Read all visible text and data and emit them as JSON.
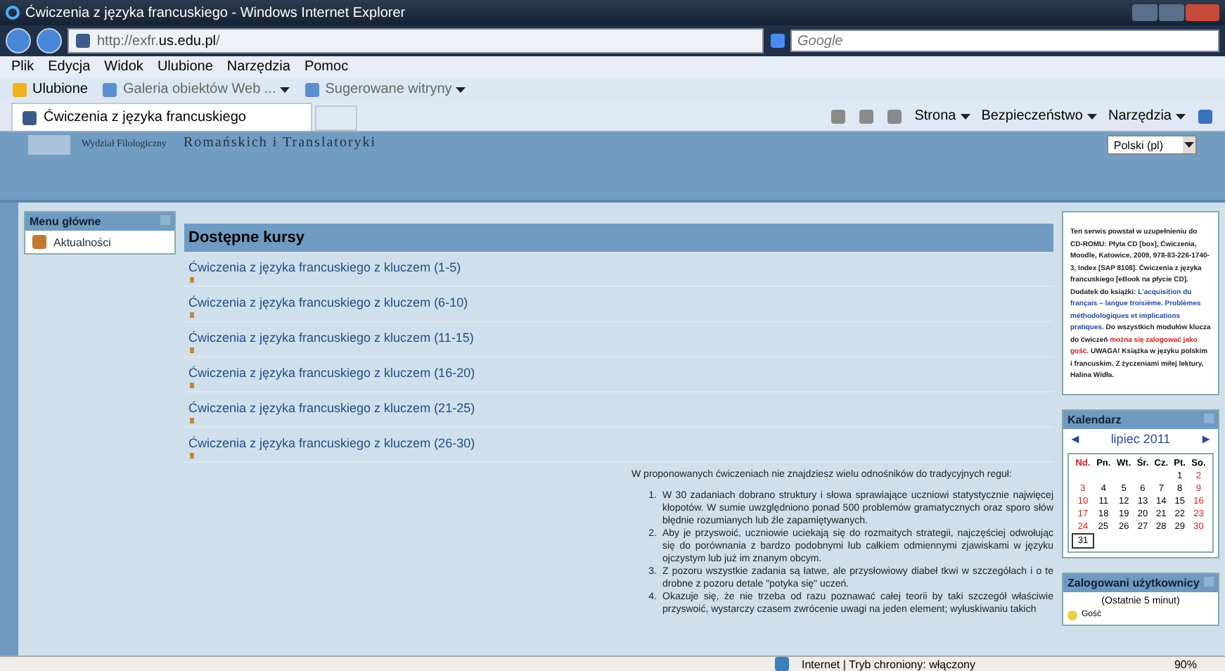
{
  "window": {
    "title": "Ćwiczenia z języka francuskiego - Windows Internet Explorer"
  },
  "address_bar": {
    "url_prefix": "http://exfr.",
    "url_domain": "us.edu.pl",
    "url_suffix": "/",
    "search_placeholder": "Google"
  },
  "menu_bar": [
    "Plik",
    "Edycja",
    "Widok",
    "Ulubione",
    "Narzędzia",
    "Pomoc"
  ],
  "favorites_bar": {
    "favorites": "Ulubione",
    "items": [
      "Galeria obiektów Web ...",
      "Sugerowane witryny"
    ]
  },
  "tab": {
    "title": "Ćwiczenia z języka francuskiego",
    "selected": true
  },
  "command_bar": [
    "Strona",
    "Bezpieczeństwo",
    "Narzędzia"
  ],
  "header": {
    "faculty": "Wydział Filologiczny",
    "institute": "Romańskich i Translatoryki",
    "language": "Polski (pl)"
  },
  "main_menu": {
    "title": "Menu główne",
    "items": [
      "Aktualności"
    ]
  },
  "courses": {
    "title": "Dostępne kursy",
    "items": [
      {
        "name": "Ćwiczenia z języka francuskiego z kluczem (1-5)"
      },
      {
        "name": "Ćwiczenia z języka francuskiego z kluczem (6-10)"
      },
      {
        "name": "Ćwiczenia z języka francuskiego z kluczem (11-15)"
      },
      {
        "name": "Ćwiczenia z języka francuskiego z kluczem (16-20)"
      },
      {
        "name": "Ćwiczenia z języka francuskiego z kluczem (21-25)"
      },
      {
        "name": "Ćwiczenia z języka francuskiego z kluczem (26-30)"
      }
    ]
  },
  "intro": {
    "lead": "W proponowanych ćwiczeniach nie znajdziesz wielu odnośników do tradycyjnych reguł:",
    "points": [
      {
        "marker": "1.",
        "text": "W 30 zadaniach dobrano struktury i słowa sprawiające uczniowi statystycznie najwięcej kłopotów. W sumie uwzględniono ponad 500 problemów gramatycznych oraz sporo słów błędnie rozumianych lub źle zapamiętywanych."
      },
      {
        "marker": "2.",
        "text": "Aby je przyswoić, uczniowie uciekają się do rozmaitych strategii, najczęściej odwołując się do porównania z bardzo podobnymi lub całkiem odmiennymi zjawiskami w języku ojczystym lub już im znanym obcym."
      },
      {
        "marker": "3.",
        "text": "Z pozoru wszystkie zadania są łatwe, ale przysłowiowy diabeł tkwi w szczegółach i o te drobne z pozoru detale \"potyka się\" uczeń."
      },
      {
        "marker": "4.",
        "text": "Okazuje się, że nie trzeba od razu poznawać całej teorii by taki szczegół właściwie przyswoić, wystarczy czasem zwrócenie uwagi na jeden element; wyłuskiwaniu takich"
      }
    ]
  },
  "info_box": [
    {
      "kind": "plain",
      "text": "Ten serwis powstał w uzupełnieniu do CD-ROMU: Płyta CD [box], Ćwiczenia, Moodle, Katowice, 2009, 978-83-226-1740-3, Index [SAP 8108]. Ćwiczenia z języka francuskiego [eBook na płycie CD]. Dodatek do książki: "
    },
    {
      "kind": "link",
      "text": "L'acquisition du français – langue troisième. Problèmes méthodologiques et implications pratiques."
    },
    {
      "kind": "plain",
      "text": " Do wszystkich modułów klucza do ćwiczeń "
    },
    {
      "kind": "alert",
      "text": "można się zalogować jako gość."
    },
    {
      "kind": "plain",
      "text": " UWAGA! Książka w języku polskim i francuskim. Z życzeniami miłej lektury, Halina Widła."
    }
  ],
  "calendar": {
    "title": "Kalendarz",
    "prev": "◄",
    "month": "lipiec 2011",
    "next": "►",
    "weekdays": [
      {
        "label": "Nd.",
        "weekend": true
      },
      {
        "label": "Pn.",
        "weekend": false
      },
      {
        "label": "Wt.",
        "weekend": false
      },
      {
        "label": "Śr.",
        "weekend": false
      },
      {
        "label": "Cz.",
        "weekend": false
      },
      {
        "label": "Pt.",
        "weekend": false
      },
      {
        "label": "So.",
        "weekend": false
      }
    ],
    "weeks": [
      [
        {
          "kind": "blank"
        },
        {
          "kind": "blank"
        },
        {
          "kind": "blank"
        },
        {
          "kind": "blank"
        },
        {
          "kind": "blank"
        },
        {
          "kind": "day",
          "day": "1",
          "weekend": false,
          "today": false
        },
        {
          "kind": "day",
          "day": "2",
          "weekend": true,
          "today": false
        }
      ],
      [
        {
          "kind": "day",
          "day": "3",
          "weekend": true,
          "today": false
        },
        {
          "kind": "day",
          "day": "4",
          "weekend": false,
          "today": false
        },
        {
          "kind": "day",
          "day": "5",
          "weekend": false,
          "today": false
        },
        {
          "kind": "day",
          "day": "6",
          "weekend": false,
          "today": false
        },
        {
          "kind": "day",
          "day": "7",
          "weekend": false,
          "today": false
        },
        {
          "kind": "day",
          "day": "8",
          "weekend": false,
          "today": false
        },
        {
          "kind": "day",
          "day": "9",
          "weekend": true,
          "today": false
        }
      ],
      [
        {
          "kind": "day",
          "day": "10",
          "weekend": true,
          "today": false
        },
        {
          "kind": "day",
          "day": "11",
          "weekend": false,
          "today": false
        },
        {
          "kind": "day",
          "day": "12",
          "weekend": false,
          "today": false
        },
        {
          "kind": "day",
          "day": "13",
          "weekend": false,
          "today": false
        },
        {
          "kind": "day",
          "day": "14",
          "weekend": false,
          "today": false
        },
        {
          "kind": "day",
          "day": "15",
          "weekend": false,
          "today": false
        },
        {
          "kind": "day",
          "day": "16",
          "weekend": true,
          "today": false
        }
      ],
      [
        {
          "kind": "day",
          "day": "17",
          "weekend": true,
          "today": false
        },
        {
          "kind": "day",
          "day": "18",
          "weekend": false,
          "today": false
        },
        {
          "kind": "day",
          "day": "19",
          "weekend": false,
          "today": false
        },
        {
          "kind": "day",
          "day": "20",
          "weekend": false,
          "today": false
        },
        {
          "kind": "day",
          "day": "21",
          "weekend": false,
          "today": false
        },
        {
          "kind": "day",
          "day": "22",
          "weekend": false,
          "today": false
        },
        {
          "kind": "day",
          "day": "23",
          "weekend": true,
          "today": false
        }
      ],
      [
        {
          "kind": "day",
          "day": "24",
          "weekend": true,
          "today": false
        },
        {
          "kind": "day",
          "day": "25",
          "weekend": false,
          "today": false
        },
        {
          "kind": "day",
          "day": "26",
          "weekend": false,
          "today": false
        },
        {
          "kind": "day",
          "day": "27",
          "weekend": false,
          "today": false
        },
        {
          "kind": "day",
          "day": "28",
          "weekend": false,
          "today": false
        },
        {
          "kind": "day",
          "day": "29",
          "weekend": false,
          "today": false
        },
        {
          "kind": "day",
          "day": "30",
          "weekend": true,
          "today": false
        }
      ],
      [
        {
          "kind": "day",
          "day": "31",
          "weekend": false,
          "today": true
        }
      ]
    ]
  },
  "online_users": {
    "title": "Zalogowani użytkownicy",
    "period": "(Ostatnie 5 minut)",
    "users": [
      "Gość"
    ]
  },
  "status_bar": {
    "zone": "Internet | Tryb chroniony: włączony",
    "zoom": "90%"
  }
}
